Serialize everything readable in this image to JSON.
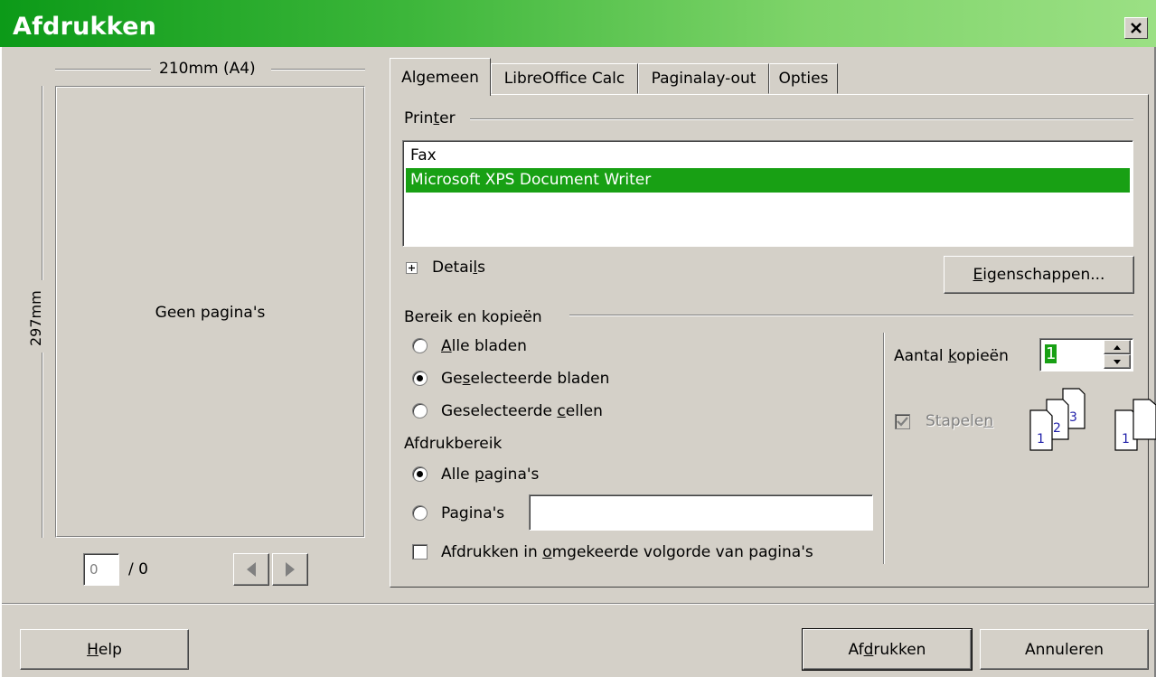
{
  "window": {
    "title": "Afdrukken",
    "close_glyph": "×"
  },
  "preview": {
    "width_label": "210mm (A4)",
    "height_label": "297mm",
    "empty_text": "Geen pagina's",
    "page_input_value": "0",
    "page_total": "/ 0"
  },
  "tabs": [
    {
      "label": "Algemeen",
      "active": true
    },
    {
      "label": "LibreOffice Calc",
      "active": false
    },
    {
      "label": "Paginalay-out",
      "active": false
    },
    {
      "label": "Opties",
      "active": false
    }
  ],
  "printer_section": {
    "legend": {
      "pre": "Prin",
      "ul": "t",
      "post": "er"
    },
    "printers": [
      "Fax",
      "Microsoft XPS Document Writer"
    ],
    "selected_index": 1,
    "details": {
      "expander": "+",
      "pre": "Detai",
      "ul": "l",
      "post": "s"
    },
    "properties_button": {
      "ul": "E",
      "post": "igenschappen..."
    }
  },
  "range_section": {
    "legend": "Bereik en kopieën",
    "options": [
      {
        "pre": "",
        "ul": "A",
        "post": "lle bladen",
        "checked": false
      },
      {
        "pre": "Ge",
        "ul": "s",
        "post": "electeerde bladen",
        "checked": true
      },
      {
        "pre": "Geselecteerde ",
        "ul": "c",
        "post": "ellen",
        "checked": false
      }
    ],
    "print_range_label": "Afdrukbereik",
    "range_options": [
      {
        "pre": "Alle ",
        "ul": "p",
        "post": "agina's",
        "checked": true
      },
      {
        "pre": "Pa",
        "ul": "g",
        "post": "ina's",
        "checked": false
      }
    ],
    "pages_input_value": "",
    "reverse_order": {
      "pre": "Afdrukken in ",
      "ul": "o",
      "post": "mgekeerde volgorde van pagina's",
      "checked": false
    }
  },
  "copies": {
    "label": {
      "pre": "Aantal ",
      "ul": "k",
      "post": "opieën"
    },
    "value": "1",
    "collate": {
      "pre": "Stapele",
      "ul": "n",
      "post": "",
      "checked": true,
      "enabled": false
    },
    "collate_icon_numbers": [
      "1",
      "2",
      "3",
      "1"
    ]
  },
  "buttons": {
    "help": {
      "ul": "H",
      "post": "elp"
    },
    "print": {
      "pre": "Af",
      "ul": "d",
      "post": "rukken"
    },
    "cancel": "Annuleren"
  },
  "colors": {
    "title_start": "#0c9a18",
    "title_end": "#9be084",
    "selection": "#18a014",
    "dialog_bg": "#d4d0c8"
  }
}
